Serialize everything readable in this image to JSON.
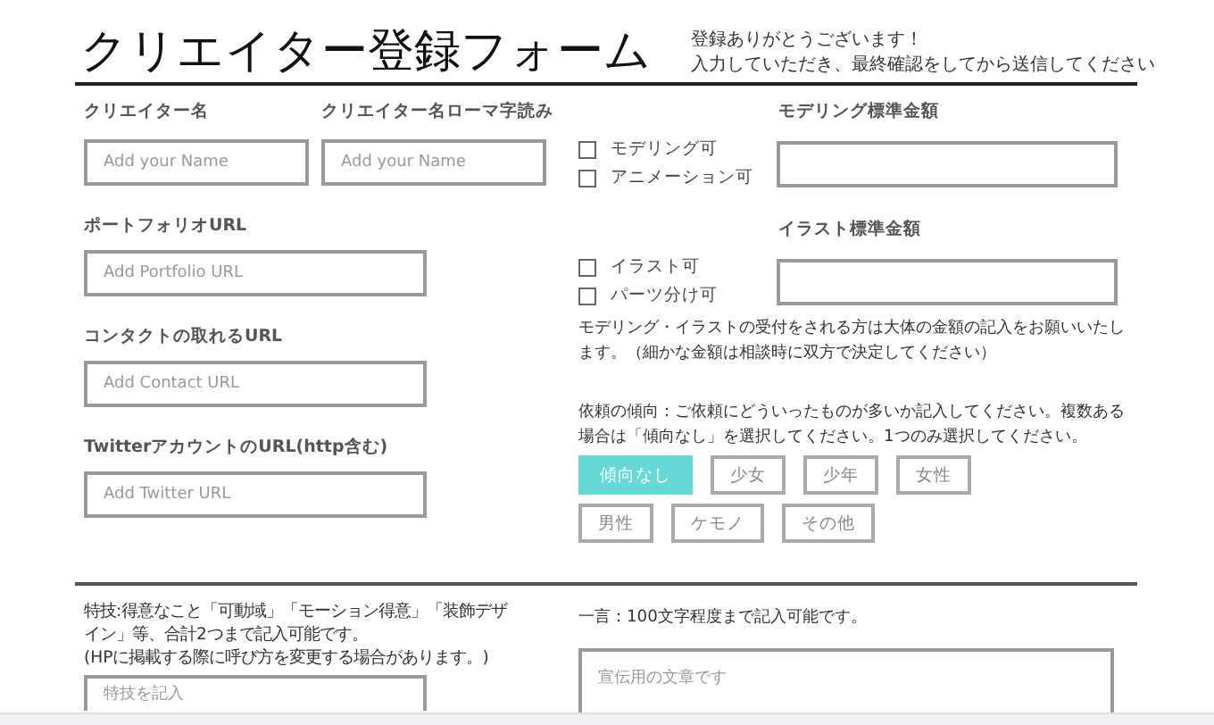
{
  "title": "クリエイター登録フォーム",
  "subtitle_lines": [
    "登録ありがとうございます！",
    "入力していただき、最終確認をしてから送信してください"
  ],
  "name_fields": [
    {
      "label": "クリエイター名",
      "placeholder": "Add your Name"
    },
    {
      "label": "クリエイター名ローマ字読み",
      "placeholder": "Add your Name"
    }
  ],
  "url_fields": [
    {
      "label": "ポートフォリオURL",
      "placeholder": "Add Portfolio URL"
    },
    {
      "label": "コンタクトの取れるURL",
      "placeholder": "Add Contact URL"
    },
    {
      "label": "TwitterアカウントのURL(http含む)",
      "placeholder": "Add Twitter URL"
    }
  ],
  "price_groups": [
    {
      "label": "モデリング標準金額",
      "options": [
        {
          "label": "モデリング可",
          "checked": false
        },
        {
          "label": "アニメーション可",
          "checked": false
        }
      ]
    },
    {
      "label": "イラスト標準金額",
      "options": [
        {
          "label": "イラスト可",
          "checked": false
        },
        {
          "label": "パーツ分け可",
          "checked": false
        }
      ]
    }
  ],
  "price_note_lines": [
    "モデリング・イラストの受付をされる方は大体の金額の記入をお願いいたし",
    "ます。（細かな金額は相談時に双方で決定してください）"
  ],
  "tendency": {
    "description_lines": [
      "依頼の傾向：ご依頼にどういったものが多いか記入してください。複数ある",
      "場合は「傾向なし」を選択してください。1つのみ選択してください。"
    ],
    "option_rows": [
      [
        {
          "label": "傾向なし",
          "selected": true
        },
        {
          "label": "少女",
          "selected": false
        },
        {
          "label": "少年",
          "selected": false
        },
        {
          "label": "女性",
          "selected": false
        }
      ],
      [
        {
          "label": "男性",
          "selected": false
        },
        {
          "label": "ケモノ",
          "selected": false
        },
        {
          "label": "その他",
          "selected": false
        }
      ]
    ]
  },
  "specialty": {
    "description_lines": [
      "特技:得意なこと「可動域」「モーション得意」「装飾デザ",
      "イン」等、合計2つまで記入可能です。",
      "(HPに掲載する際に呼び方を変更する場合があります。)"
    ],
    "placeholder": "特技を記入"
  },
  "comment": {
    "label": "一言：100文字程度まで記入可能です。",
    "placeholder": "宣伝用の文章です"
  }
}
